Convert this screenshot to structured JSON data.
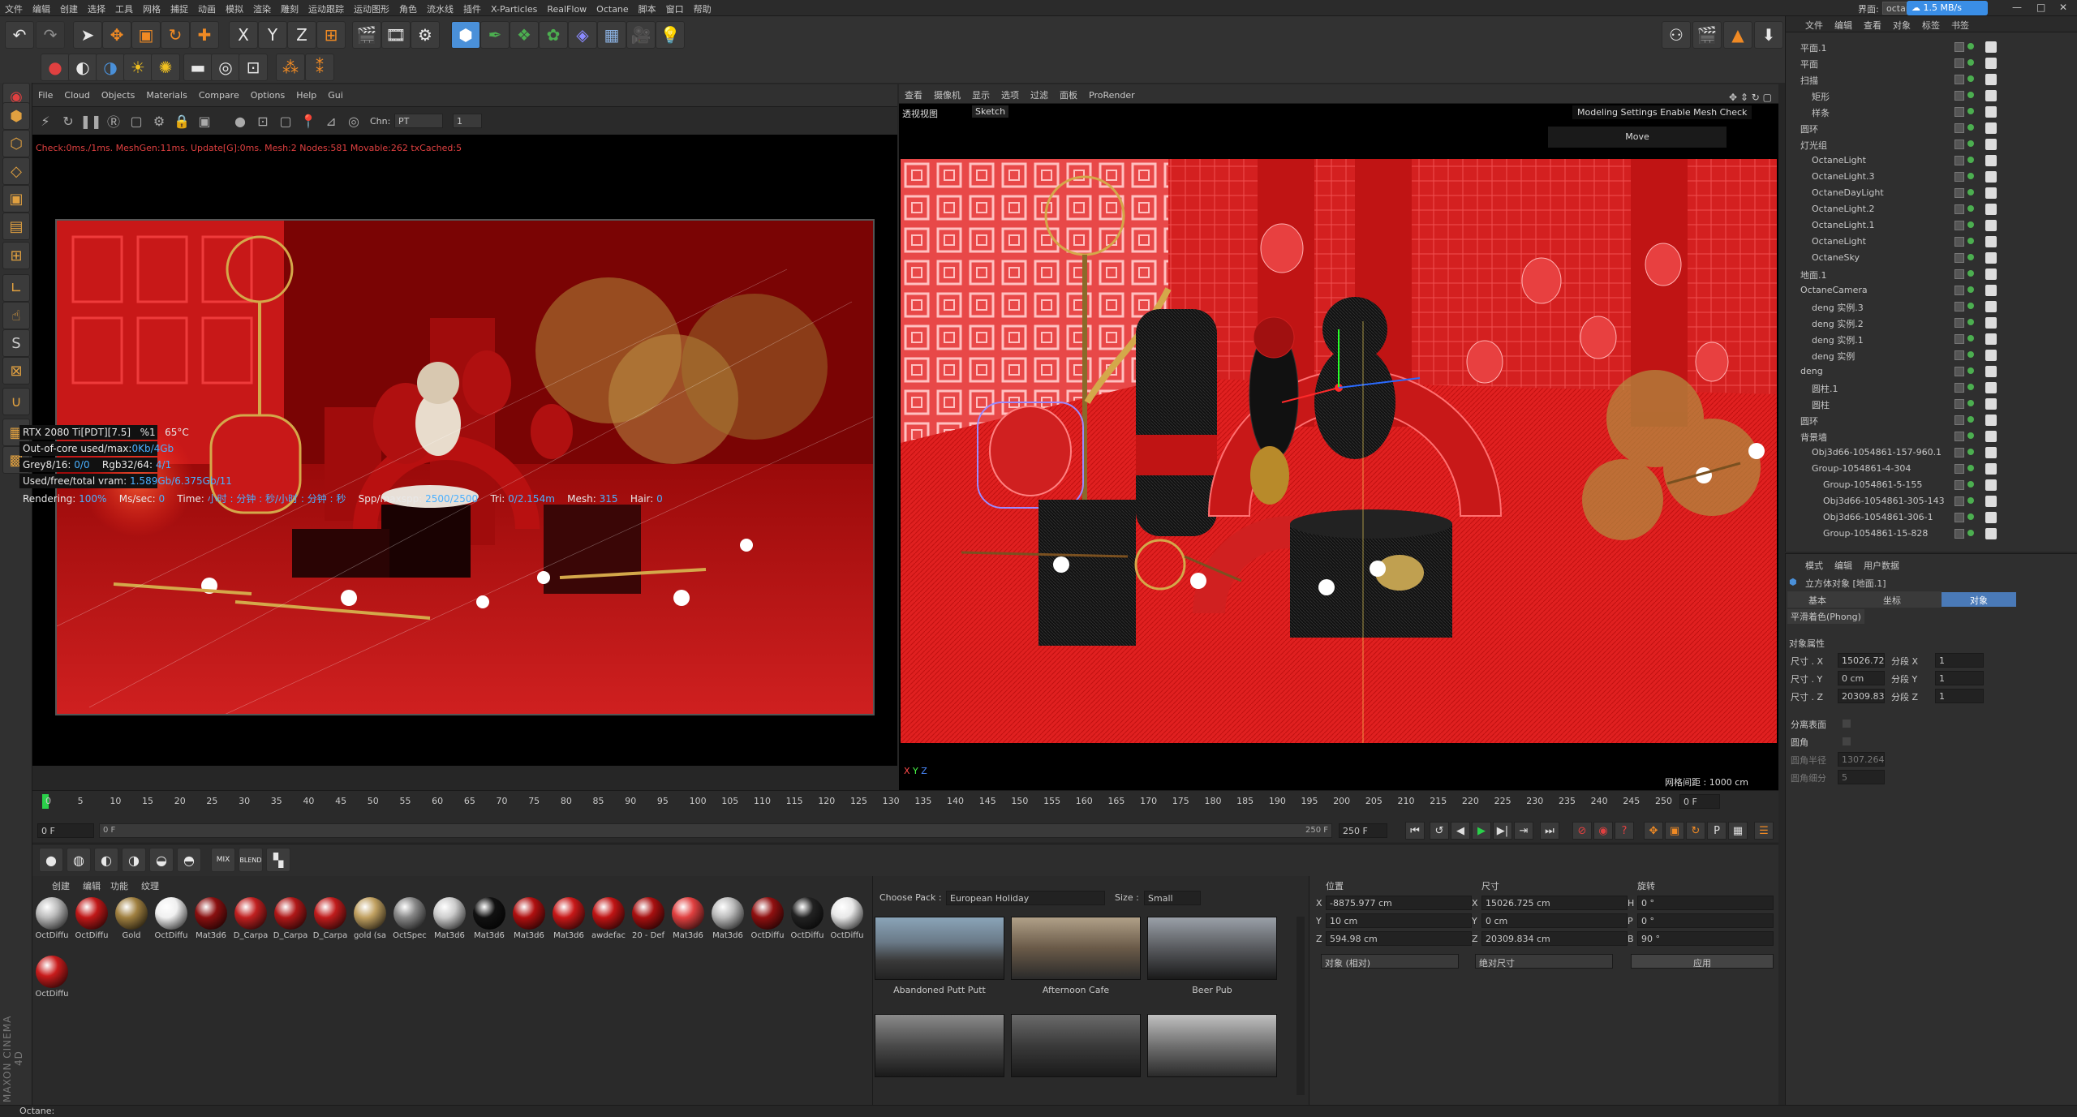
{
  "menubar": {
    "items": [
      "文件",
      "编辑",
      "创建",
      "选择",
      "工具",
      "网格",
      "捕捉",
      "动画",
      "模拟",
      "渲染",
      "雕刻",
      "运动跟踪",
      "运动图形",
      "角色",
      "流水线",
      "插件",
      "X-Particles",
      "RealFlow",
      "Octane",
      "脚本",
      "窗口",
      "帮助"
    ],
    "layout_label": "界面:",
    "layout_value": "octane",
    "net_speed": "1.5 MB/s"
  },
  "main_toolbar": {
    "axis_buttons": [
      "X",
      "Y",
      "Z"
    ]
  },
  "left_viewport": {
    "menu": [
      "File",
      "Cloud",
      "Objects",
      "Materials",
      "Compare",
      "Options",
      "Help",
      "Gui"
    ],
    "channel_label": "Chn:",
    "channel_value": "PT",
    "channel_num": "1",
    "info_line": "Check:0ms./1ms. MeshGen:11ms. Update[G]:0ms. Mesh:2 Nodes:581 Movable:262 txCached:5",
    "stats": {
      "gpu": "RTX 2080 Ti[PDT][7.5]",
      "pct": "%1",
      "temp": "65°C",
      "out_of_core_label": "Out-of-core used/max:",
      "out_of_core_value": "0Kb/4Gb",
      "grey_label": "Grey8/16:",
      "grey_value": "0/0",
      "rgb_label": "Rgb32/64:",
      "rgb_value": "4/1",
      "vram_label": "Used/free/total vram:",
      "vram_value": "1.589Gb/6.375Gb/11"
    },
    "render_line": {
      "rendering_label": "Rendering:",
      "rendering_value": "100%",
      "ms_label": "Ms/sec:",
      "ms_value": "0",
      "time_label": "Time:",
      "time_value": "小时 : 分钟 : 秒/小时 : 分钟 : 秒",
      "spp_label": "Spp/maxspp:",
      "spp_value": "2500/2500",
      "tri_label": "Tri:",
      "tri_value": "0/2.154m",
      "mesh_label": "Mesh:",
      "mesh_value": "315",
      "hair_label": "Hair:",
      "hair_value": "0"
    }
  },
  "right_viewport": {
    "menu": [
      "查看",
      "摄像机",
      "显示",
      "选项",
      "过滤",
      "面板",
      "ProRender"
    ],
    "view_name": "透视视图",
    "sketch_label": "Sketch",
    "mesh_check": "Modeling Settings Enable Mesh Check",
    "move_label": "Move",
    "grid_info": "网格间距 : 1000 cm"
  },
  "object_manager": {
    "tabs": [
      "文件",
      "编辑",
      "查看",
      "对象",
      "标签",
      "书签"
    ],
    "rows": [
      "平面.1",
      "平面",
      "扫描",
      "矩形",
      "样条",
      "圆环",
      "灯光组",
      "OctaneLight",
      "OctaneLight.3",
      "OctaneDayLight",
      "OctaneLight.2",
      "OctaneLight.1",
      "OctaneLight",
      "OctaneSky",
      "地面.1",
      "OctaneCamera",
      "deng 实例.3",
      "deng 实例.2",
      "deng 实例.1",
      "deng 实例",
      "deng",
      "圆柱.1",
      "圆柱",
      "圆环",
      "背景墙",
      "Obj3d66-1054861-157-960.1",
      "Group-1054861-4-304",
      "Group-1054861-5-155",
      "Obj3d66-1054861-305-143",
      "Obj3d66-1054861-306-1",
      "Group-1054861-15-828"
    ]
  },
  "attributes": {
    "tabs": [
      "模式",
      "编辑",
      "用户数据"
    ],
    "title": "立方体对象 [地面.1]",
    "subtabs": [
      "基本",
      "坐标",
      "对象"
    ],
    "phong": "平滑着色(Phong)",
    "section": "对象属性",
    "size_x_label": "尺寸 . X",
    "size_x": "15026.725",
    "size_y_label": "尺寸 . Y",
    "size_y": "0 cm",
    "size_z_label": "尺寸 . Z",
    "size_z": "20309.834",
    "seg_x_label": "分段 X",
    "seg_x": "1",
    "seg_y_label": "分段 Y",
    "seg_y": "1",
    "seg_z_label": "分段 Z",
    "seg_z": "1",
    "separate": "分离表面",
    "fillet": "圆角",
    "fillet_radius_label": "圆角半径",
    "fillet_radius": "1307.264",
    "fillet_seg_label": "圆角细分",
    "fillet_seg": "5"
  },
  "timeline": {
    "ticks": [
      "0",
      "5",
      "10",
      "15",
      "20",
      "25",
      "30",
      "35",
      "40",
      "45",
      "50",
      "55",
      "60",
      "65",
      "70",
      "75",
      "80",
      "85",
      "90",
      "95",
      "100",
      "105",
      "110",
      "115",
      "120",
      "125",
      "130",
      "135",
      "140",
      "145",
      "150",
      "155",
      "160",
      "165",
      "170",
      "175",
      "180",
      "185",
      "190",
      "195",
      "200",
      "205",
      "210",
      "215",
      "220",
      "225",
      "230",
      "235",
      "240",
      "245",
      "250"
    ],
    "current_frame": "0 F",
    "start_frame": "0 F",
    "min_frame": "0 F",
    "max_frame_a": "250 F",
    "max_frame_b": "250 F"
  },
  "material_manager": {
    "menu": [
      "创建",
      "编辑",
      "功能",
      "纹理"
    ],
    "materials": [
      {
        "label": "OctDiffu",
        "color": "#bbbbbb"
      },
      {
        "label": "OctDiffu",
        "color": "#c01818"
      },
      {
        "label": "Gold",
        "color": "#a08040"
      },
      {
        "label": "OctDiffu",
        "color": "#f0f0f0"
      },
      {
        "label": "Mat3d6",
        "color": "#8a1010"
      },
      {
        "label": "D_Carpa",
        "color": "#c02020"
      },
      {
        "label": "D_Carpa",
        "color": "#b01818"
      },
      {
        "label": "D_Carpa",
        "color": "#c01c1c"
      },
      {
        "label": "gold (sa",
        "color": "#c0a060"
      },
      {
        "label": "OctSpec",
        "color": "#888888"
      },
      {
        "label": "Mat3d6",
        "color": "#cccccc"
      },
      {
        "label": "Mat3d6",
        "color": "#111111"
      },
      {
        "label": "Mat3d6",
        "color": "#b01010"
      },
      {
        "label": "Mat3d6",
        "color": "#c81818"
      },
      {
        "label": "awdefac",
        "color": "#c01414"
      },
      {
        "label": "20 - Def",
        "color": "#a81010"
      },
      {
        "label": "Mat3d6",
        "color": "#e04040"
      },
      {
        "label": "Mat3d6",
        "color": "#bbbbbb"
      },
      {
        "label": "OctDiffu",
        "color": "#901010"
      },
      {
        "label": "OctDiffu",
        "color": "#222222"
      },
      {
        "label": "OctDiffu",
        "color": "#e8e8e8"
      },
      {
        "label": "OctDiffu",
        "color": "#c81c1c"
      }
    ]
  },
  "hdri": {
    "choose_label": "Choose Pack :",
    "choose_value": "European Holiday",
    "size_label": "Size :",
    "size_value": "Small",
    "items": [
      "Abandoned Putt Putt",
      "Afternoon Cafe",
      "Beer Pub",
      "",
      "",
      ""
    ]
  },
  "coordinates": {
    "headers": [
      "位置",
      "尺寸",
      "旋转"
    ],
    "pos": [
      "-8875.977 cm",
      "10 cm",
      "594.98 cm"
    ],
    "size": [
      "15026.725 cm",
      "0 cm",
      "20309.834 cm"
    ],
    "rot": [
      "0 °",
      "0 °",
      "90 °"
    ],
    "pos_labels": [
      "X",
      "Y",
      "Z"
    ],
    "rot_labels": [
      "H",
      "P",
      "B"
    ],
    "mode_a": "对象 (相对)",
    "mode_b": "绝对尺寸",
    "apply": "应用"
  },
  "statusbar": {
    "text": "Octane:"
  },
  "colors": {
    "accent": "#4a90d9",
    "warn": "#e04040",
    "highlight": "#4ab0ff"
  }
}
